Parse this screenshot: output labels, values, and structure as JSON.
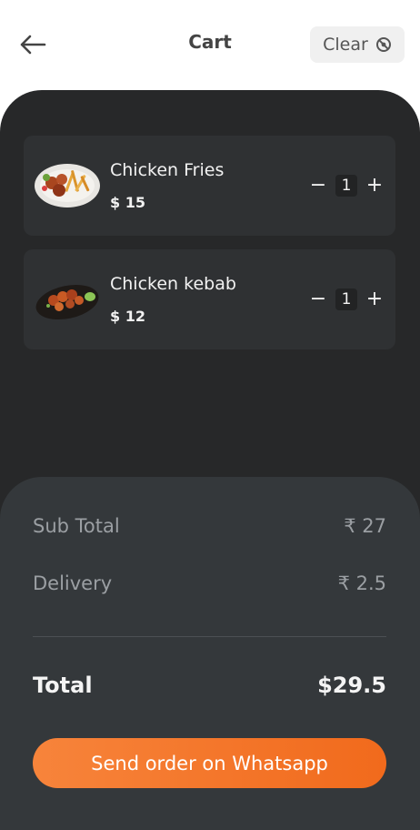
{
  "header": {
    "title": "Cart",
    "clear_label": "Clear"
  },
  "cart": {
    "items": [
      {
        "name": "Chicken Fries",
        "price": "$ 15",
        "quantity": "1"
      },
      {
        "name": "Chicken kebab",
        "price": "$ 12",
        "quantity": "1"
      }
    ]
  },
  "summary": {
    "subtotal_label": "Sub Total",
    "subtotal_value": "₹ 27",
    "delivery_label": "Delivery",
    "delivery_value": "₹ 2.5",
    "total_label": "Total",
    "total_value": "$29.5",
    "order_button": "Send order on Whatsapp"
  },
  "qty_controls": {
    "decrement": "−",
    "increment": "+"
  },
  "colors": {
    "background_dark": "#272829",
    "card": "#2f3133",
    "summary_panel": "#34383b",
    "accent": "#f47a2d"
  },
  "icons": {
    "back": "arrow-left-icon",
    "clear": "clear-circle-icon"
  }
}
